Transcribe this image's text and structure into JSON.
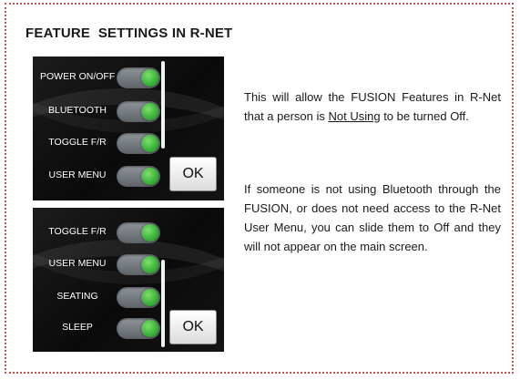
{
  "heading": "FEATURE  SETTINGS IN R-NET",
  "screens": [
    {
      "rows": [
        {
          "label": "POWER ON/OFF",
          "state": "on"
        },
        {
          "label": "BLUETOOTH",
          "state": "on"
        },
        {
          "label": "TOGGLE F/R",
          "state": "on"
        },
        {
          "label": "USER MENU",
          "state": "on"
        }
      ],
      "ok_label": "OK"
    },
    {
      "rows": [
        {
          "label": "TOGGLE F/R",
          "state": "on"
        },
        {
          "label": "USER MENU",
          "state": "on"
        },
        {
          "label": "SEATING",
          "state": "on"
        },
        {
          "label": "SLEEP",
          "state": "on"
        }
      ],
      "ok_label": "OK"
    }
  ],
  "paragraph1": {
    "part1": "This will allow the FUSION Features in R-Net that a person is ",
    "underlined": "Not Using",
    "part2": " to be turned Off."
  },
  "paragraph2": "If someone is not using Bluetooth through the FUSION, or does not need access to the R-Net User Menu, you can slide them to Off and they will not appear on the main screen.",
  "colors": {
    "border": "#c0504d",
    "toggle_on": "#3cb43c",
    "screen_bg": "#111111"
  }
}
